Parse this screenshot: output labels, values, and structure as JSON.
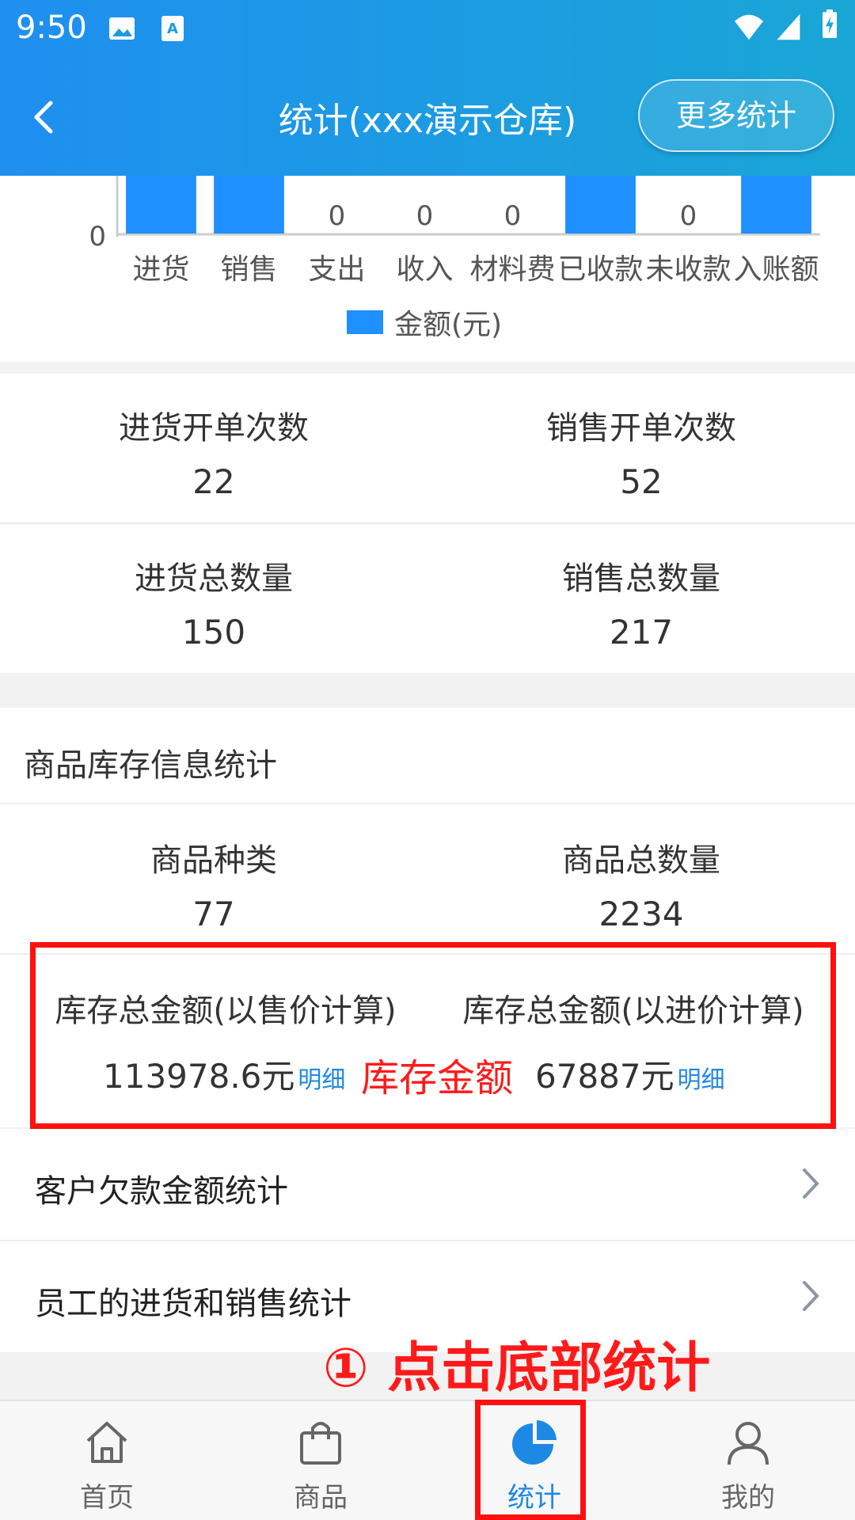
{
  "status_bar": {
    "time": "9:50"
  },
  "header": {
    "title": "统计(xxx演示仓库)",
    "more_button": "更多统计"
  },
  "chart_data": {
    "type": "bar",
    "categories": [
      "进货",
      "销售",
      "支出",
      "收入",
      "材料费",
      "已收款",
      "未收款",
      "入账额"
    ],
    "series": [
      {
        "name": "金额(元)",
        "values": [
          null,
          null,
          0,
          0,
          0,
          null,
          0,
          null
        ]
      }
    ],
    "data_labels": [
      "",
      "",
      "0",
      "0",
      "0",
      "",
      "0",
      ""
    ],
    "y_tick_labels": [
      "0"
    ],
    "legend": "bottom-center",
    "color": "#1e90ff"
  },
  "stats": {
    "purchase_orders": {
      "label": "进货开单次数",
      "value": "22"
    },
    "sales_orders": {
      "label": "销售开单次数",
      "value": "52"
    },
    "purchase_qty": {
      "label": "进货总数量",
      "value": "150"
    },
    "sales_qty": {
      "label": "销售总数量",
      "value": "217"
    }
  },
  "inventory": {
    "title": "商品库存信息统计",
    "kinds": {
      "label": "商品种类",
      "value": "77"
    },
    "total_qty": {
      "label": "商品总数量",
      "value": "2234"
    },
    "amount_sale": {
      "label": "库存总金额(以售价计算)",
      "value": "113978.6元",
      "detail": "明细"
    },
    "amount_cost": {
      "label": "库存总金额(以进价计算)",
      "value": "67887元",
      "detail": "明细"
    }
  },
  "annotations": {
    "inventory_amount": "库存金额",
    "step": "① 点击底部统计"
  },
  "list": [
    {
      "label": "客户欠款金额统计"
    },
    {
      "label": "员工的进货和销售统计"
    }
  ],
  "bottom_nav": [
    {
      "label": "首页",
      "icon": "home-icon"
    },
    {
      "label": "商品",
      "icon": "bag-icon"
    },
    {
      "label": "统计",
      "icon": "pie-chart-icon",
      "active": true
    },
    {
      "label": "我的",
      "icon": "user-icon"
    }
  ],
  "colors": {
    "primary": "#1e88e5",
    "annotation": "#ff1010"
  }
}
